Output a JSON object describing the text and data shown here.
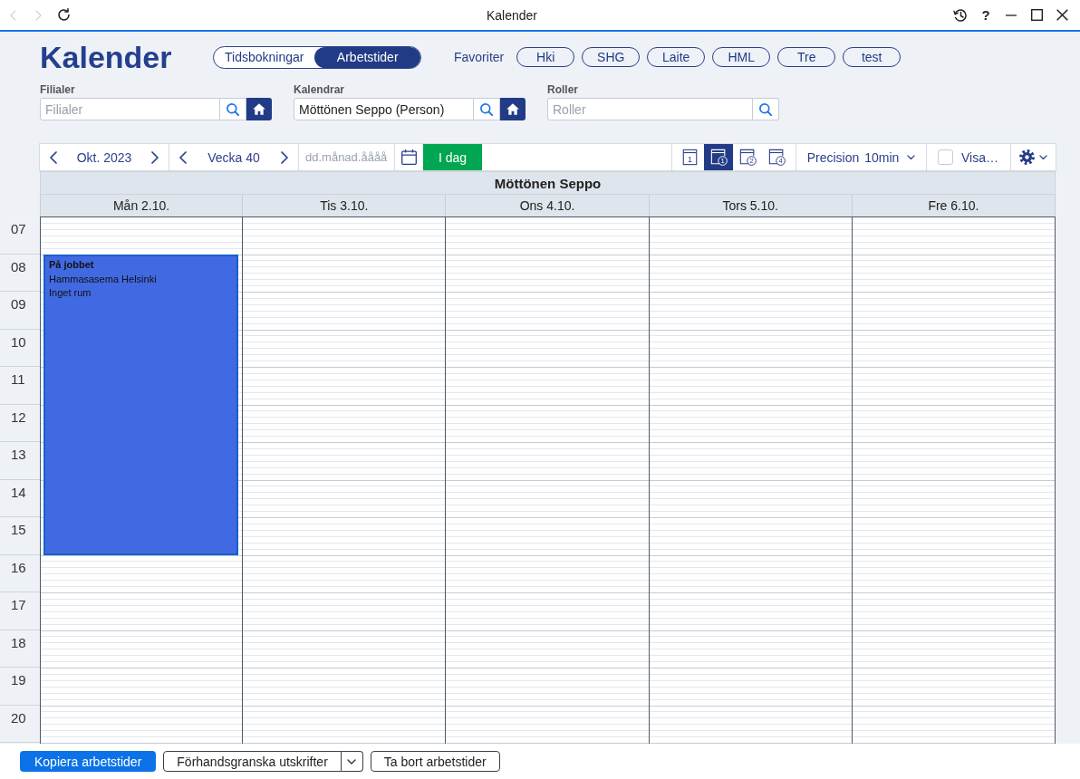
{
  "window": {
    "title": "Kalender",
    "nav": [
      {
        "kind": "back",
        "disabled": true
      },
      {
        "kind": "forward",
        "disabled": true
      },
      {
        "kind": "reload",
        "disabled": false
      }
    ],
    "controls": [
      {
        "kind": "history"
      },
      {
        "kind": "help",
        "label": "?"
      },
      {
        "kind": "minimize"
      },
      {
        "kind": "maximize"
      },
      {
        "kind": "close"
      }
    ]
  },
  "header": {
    "title": "Kalender",
    "modes": [
      {
        "label": "Tidsbokningar",
        "selected": false
      },
      {
        "label": "Arbetstider",
        "selected": true
      }
    ],
    "favorites_label": "Favoriter",
    "favorites": [
      "Hki",
      "SHG",
      "Laite",
      "HML",
      "Tre",
      "test"
    ]
  },
  "filters": [
    {
      "label": "Filialer",
      "placeholder": "Filialer",
      "home": true
    },
    {
      "label": "Kalendrar",
      "value": "Möttönen Seppo (Person)",
      "home": true
    },
    {
      "label": "Roller",
      "placeholder": "Roller",
      "home": false
    }
  ],
  "toolbar": {
    "month": "Okt. 2023",
    "week": "Vecka 40",
    "date_field": {
      "placeholder": "dd.månad.åååå"
    },
    "today_button": "I dag",
    "views": [
      {
        "label": "1",
        "kind": "plain",
        "selected": false
      },
      {
        "label": "1",
        "kind": "circled",
        "selected": true
      },
      {
        "label": "2",
        "kind": "circled",
        "selected": false
      },
      {
        "label": "4",
        "kind": "circled",
        "selected": false
      }
    ],
    "precision": {
      "label": "Precision",
      "value": "10min"
    },
    "show": {
      "label": "Visa…",
      "checked": false
    }
  },
  "calendar": {
    "person": "Möttönen Seppo",
    "days": [
      {
        "label": "Mån 2.10.",
        "events": [
          {
            "title": "På jobbet",
            "lines": [
              "Hammasasema Helsinki",
              "Inget rum"
            ]
          }
        ]
      },
      {
        "label": "Tis 3.10."
      },
      {
        "label": "Ons 4.10."
      },
      {
        "label": "Tors 5.10."
      },
      {
        "label": "Fre 6.10."
      }
    ],
    "hours": [
      "07",
      "08",
      "09",
      "10",
      "11",
      "12",
      "13",
      "14",
      "15",
      "16",
      "17",
      "18",
      "19",
      "20"
    ]
  },
  "bottom_bar": {
    "buttons": [
      {
        "label": "Kopiera arbetstider",
        "kind": "primary"
      },
      {
        "label": "Förhandsgranska utskrifter",
        "kind": "split"
      },
      {
        "label": "Ta bort arbetstider",
        "kind": "default"
      }
    ]
  }
}
